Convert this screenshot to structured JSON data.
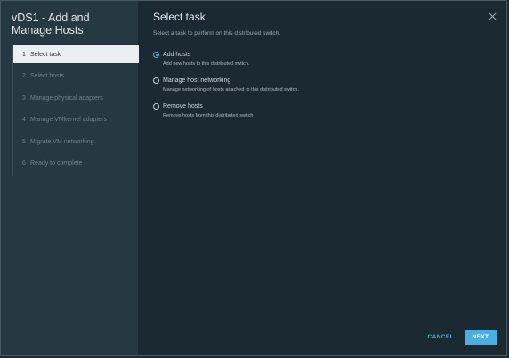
{
  "wizard": {
    "title": "vDS1 - Add and Manage Hosts",
    "steps": [
      {
        "num": "1",
        "label": "Select task",
        "active": true
      },
      {
        "num": "2",
        "label": "Select hosts",
        "active": false
      },
      {
        "num": "3",
        "label": "Manage physical adapters",
        "active": false
      },
      {
        "num": "4",
        "label": "Manage VMkernel adapters",
        "active": false
      },
      {
        "num": "5",
        "label": "Migrate VM networking",
        "active": false
      },
      {
        "num": "6",
        "label": "Ready to complete",
        "active": false
      }
    ]
  },
  "main": {
    "title": "Select task",
    "subtitle": "Select a task to perform on this distributed switch.",
    "options": [
      {
        "label": "Add hosts",
        "description": "Add new hosts to this distributed switch.",
        "selected": true
      },
      {
        "label": "Manage host networking",
        "description": "Manage networking of hosts attached to this distributed switch.",
        "selected": false
      },
      {
        "label": "Remove hosts",
        "description": "Remove hosts from this distributed switch.",
        "selected": false
      }
    ]
  },
  "footer": {
    "cancel_label": "CANCEL",
    "next_label": "NEXT"
  },
  "icons": {
    "close": "close-icon"
  },
  "colors": {
    "accent": "#49aee0",
    "background": "#1b2a32",
    "sidebar": "#263842"
  }
}
